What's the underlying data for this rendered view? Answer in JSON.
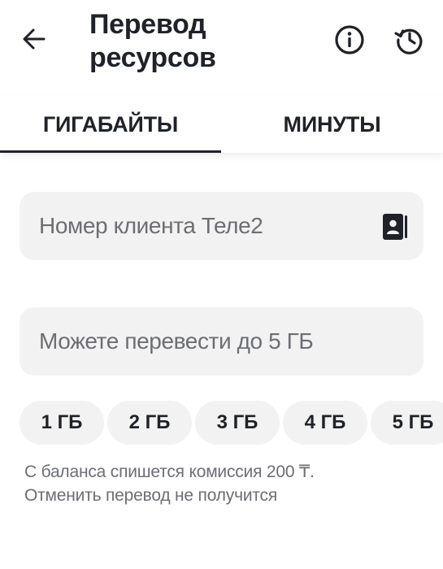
{
  "header": {
    "title_line1": "Перевод",
    "title_line2": "ресурсов",
    "back_icon": "arrow-left-icon",
    "info_icon": "info-icon",
    "history_icon": "history-icon"
  },
  "tabs": [
    {
      "label": "ГИГАБАЙТЫ",
      "selected": true
    },
    {
      "label": "МИНУТЫ",
      "selected": false
    }
  ],
  "form": {
    "phone_placeholder": "Номер клиента Теле2",
    "contacts_icon": "contacts-book-icon",
    "amount_placeholder": "Можете перевести до 5 ГБ"
  },
  "amount_chips": [
    "1 ГБ",
    "2 ГБ",
    "3 ГБ",
    "4 ГБ",
    "5 ГБ"
  ],
  "note": {
    "line1": "С баланса спишется комиссия 200 ₸.",
    "line2": "Отменить перевод не получится"
  },
  "colors": {
    "text": "#1f2229",
    "muted": "#6c6e73",
    "field_bg": "#f2f2f3"
  }
}
